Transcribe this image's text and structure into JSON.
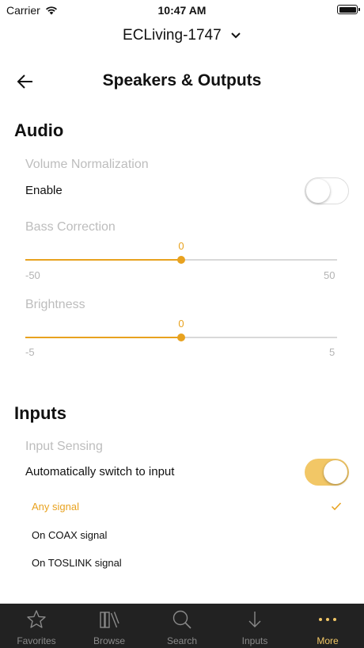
{
  "status_bar": {
    "carrier": "Carrier",
    "time": "10:47 AM"
  },
  "device": {
    "name": "ECLiving-1747"
  },
  "header": {
    "title": "Speakers & Outputs"
  },
  "audio": {
    "title": "Audio",
    "volume_normalization": {
      "label": "Volume Normalization",
      "enable_label": "Enable",
      "enabled": false
    },
    "bass_correction": {
      "label": "Bass Correction",
      "value": "0",
      "min": "-50",
      "max": "50",
      "numeric_value": 0
    },
    "brightness": {
      "label": "Brightness",
      "value": "0",
      "min": "-5",
      "max": "5",
      "numeric_value": 0
    }
  },
  "inputs": {
    "title": "Inputs",
    "input_sensing": {
      "label": "Input Sensing",
      "auto_switch_label": "Automatically switch to input",
      "enabled": true
    },
    "options": [
      {
        "label": "Any signal",
        "selected": true
      },
      {
        "label": "On COAX signal",
        "selected": false
      },
      {
        "label": "On TOSLINK signal",
        "selected": false
      }
    ]
  },
  "tab_bar": {
    "items": [
      {
        "label": "Favorites",
        "icon": "star-icon"
      },
      {
        "label": "Browse",
        "icon": "library-icon"
      },
      {
        "label": "Search",
        "icon": "search-icon"
      },
      {
        "label": "Inputs",
        "icon": "arrow-down-icon"
      },
      {
        "label": "More",
        "icon": "more-icon",
        "active": true
      }
    ]
  },
  "colors": {
    "accent": "#e8a21f",
    "toggle_on": "#f2c766",
    "tab_bar_bg": "#222222"
  }
}
